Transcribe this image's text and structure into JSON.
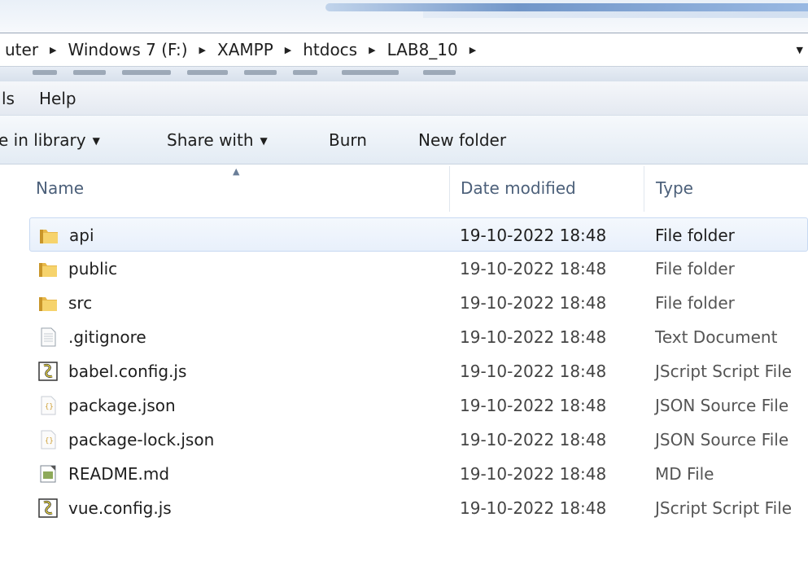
{
  "breadcrumb": {
    "items": [
      "uter",
      "Windows 7 (F:)",
      "XAMPP",
      "htdocs",
      "LAB8_10"
    ]
  },
  "menu": {
    "items": [
      "ls",
      "Help"
    ]
  },
  "toolbar": {
    "include_library": "e in library",
    "share_with": "Share with",
    "burn": "Burn",
    "new_folder": "New folder"
  },
  "columns": {
    "name": "Name",
    "date": "Date modified",
    "type": "Type"
  },
  "files": [
    {
      "name": "api",
      "date": "19-10-2022 18:48",
      "type": "File folder",
      "icon": "folder-icon"
    },
    {
      "name": "public",
      "date": "19-10-2022 18:48",
      "type": "File folder",
      "icon": "folder-icon"
    },
    {
      "name": "src",
      "date": "19-10-2022 18:48",
      "type": "File folder",
      "icon": "folder-icon"
    },
    {
      "name": ".gitignore",
      "date": "19-10-2022 18:48",
      "type": "Text Document",
      "icon": "text-file-icon"
    },
    {
      "name": "babel.config.js",
      "date": "19-10-2022 18:48",
      "type": "JScript Script File",
      "icon": "script-file-icon"
    },
    {
      "name": "package.json",
      "date": "19-10-2022 18:48",
      "type": "JSON Source File",
      "icon": "json-file-icon"
    },
    {
      "name": "package-lock.json",
      "date": "19-10-2022 18:48",
      "type": "JSON Source File",
      "icon": "json-file-icon"
    },
    {
      "name": "README.md",
      "date": "19-10-2022 18:48",
      "type": "MD File",
      "icon": "md-file-icon"
    },
    {
      "name": "vue.config.js",
      "date": "19-10-2022 18:48",
      "type": "JScript Script File",
      "icon": "script-file-icon"
    }
  ],
  "colors": {
    "selection": "#e8f0fb",
    "selection_border": "#c7d9f2",
    "header_text": "#4c607a"
  }
}
